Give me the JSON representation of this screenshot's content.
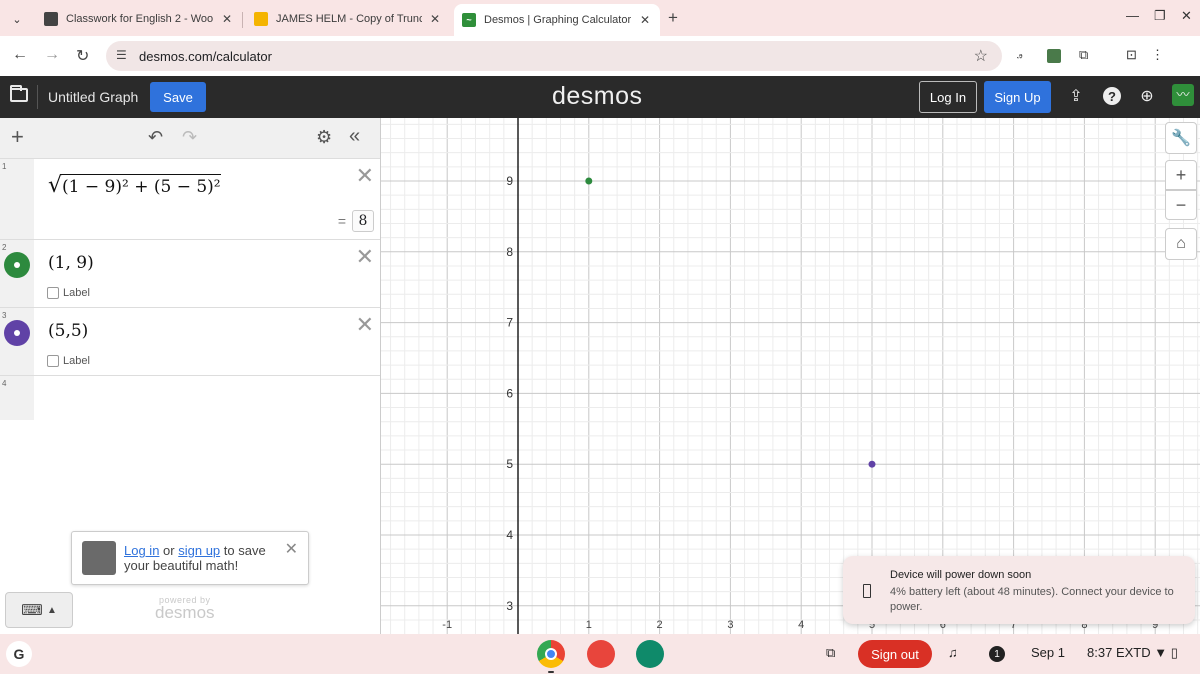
{
  "browser": {
    "tabs": [
      {
        "label": "Classwork for English 2 - Woo",
        "favicon_color": "#444444"
      },
      {
        "label": "JAMES HELM - Copy of Trunca",
        "favicon_color": "#f4b400"
      },
      {
        "label": "Desmos | Graphing Calculator",
        "favicon_color": "#2f8f3a",
        "active": true
      }
    ],
    "url": "desmos.com/calculator"
  },
  "header": {
    "graph_title": "Untitled Graph",
    "save_label": "Save",
    "logo": "desmos",
    "login_label": "Log In",
    "signup_label": "Sign Up"
  },
  "expressions": [
    {
      "index": "1",
      "latex_text": "(1 − 9)² + (5 − 5)²",
      "result": "8"
    },
    {
      "index": "2",
      "text": "(1, 9)",
      "color": "#2d8a3e",
      "label": "Label"
    },
    {
      "index": "3",
      "text": "(5,5)",
      "color": "#6042a6",
      "label": "Label"
    },
    {
      "index": "4",
      "text": ""
    }
  ],
  "promo": {
    "login": "Log in",
    "or": "or",
    "signup": "sign up",
    "rest": "to save your beautiful math!"
  },
  "powered": {
    "line1": "powered by",
    "line2": "desmos"
  },
  "graph": {
    "x_ticks": [
      "-1",
      "1",
      "2",
      "3",
      "4",
      "5",
      "6",
      "7",
      "8",
      "9"
    ],
    "y_ticks": [
      "3",
      "4",
      "5",
      "6",
      "7",
      "8",
      "9"
    ],
    "points": [
      {
        "x": 1,
        "y": 9,
        "color": "#2d8a3e"
      },
      {
        "x": 5,
        "y": 5,
        "color": "#6042a6"
      }
    ]
  },
  "toast": {
    "title": "Device will power down soon",
    "body": "4% battery left (about 48 minutes). Connect your device to power."
  },
  "shelf": {
    "signout_label": "Sign out",
    "notification_count": "1",
    "date": "Sep 1",
    "time": "8:37",
    "extd": "EXTD"
  }
}
